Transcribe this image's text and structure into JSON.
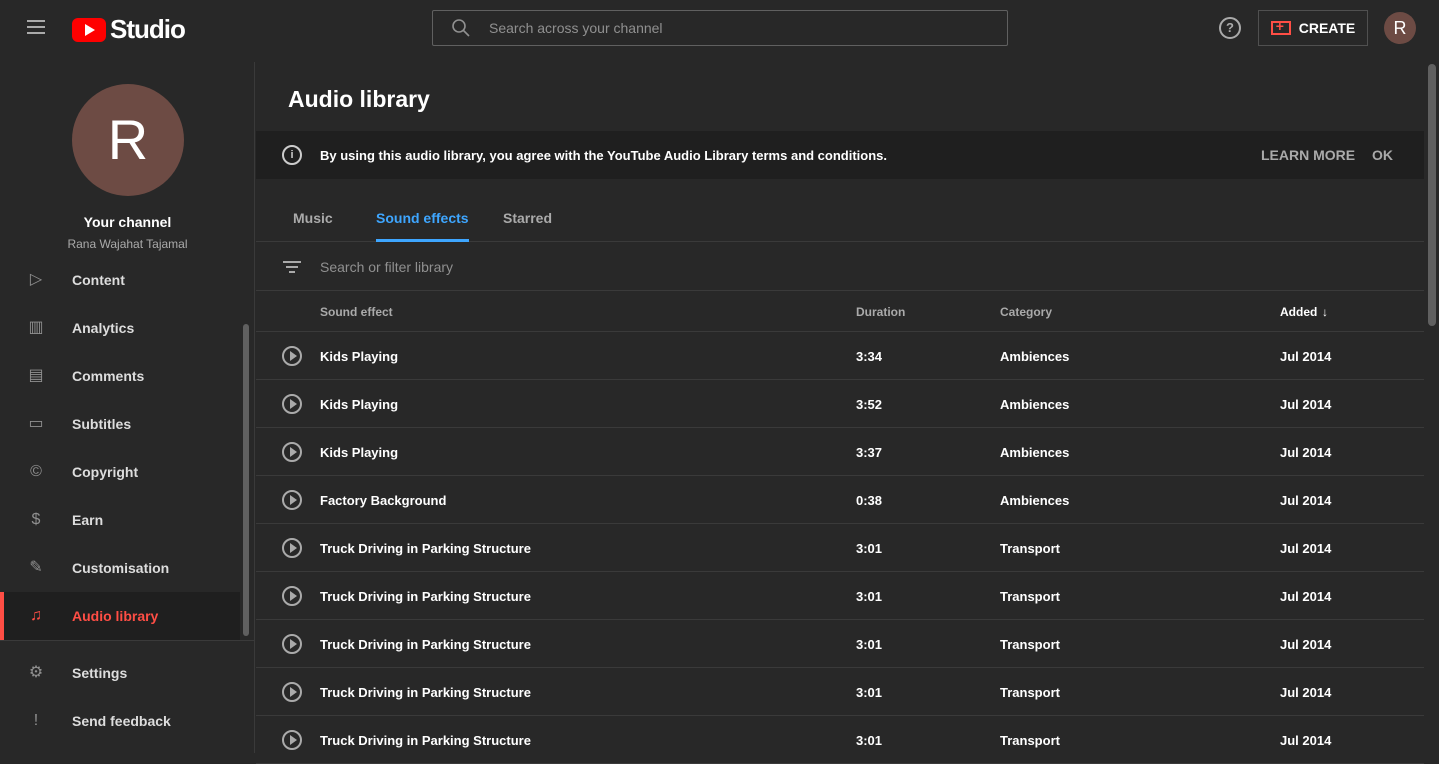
{
  "header": {
    "logo_text": "Studio",
    "search_placeholder": "Search across your channel",
    "help_label": "?",
    "create_label": "CREATE",
    "avatar_initial": "R"
  },
  "sidebar": {
    "avatar_initial": "R",
    "channel_title": "Your channel",
    "channel_name": "Rana Wajahat Tajamal",
    "items": [
      {
        "label": "Content",
        "icon": "content-icon"
      },
      {
        "label": "Analytics",
        "icon": "analytics-icon"
      },
      {
        "label": "Comments",
        "icon": "comments-icon"
      },
      {
        "label": "Subtitles",
        "icon": "subtitles-icon"
      },
      {
        "label": "Copyright",
        "icon": "copyright-icon"
      },
      {
        "label": "Earn",
        "icon": "earn-icon"
      },
      {
        "label": "Customisation",
        "icon": "customisation-icon"
      },
      {
        "label": "Audio library",
        "icon": "audio-library-icon",
        "active": true
      }
    ],
    "footer_items": [
      {
        "label": "Settings",
        "icon": "settings-icon"
      },
      {
        "label": "Send feedback",
        "icon": "feedback-icon"
      }
    ]
  },
  "main": {
    "title": "Audio library",
    "banner": {
      "message": "By using this audio library, you agree with the YouTube Audio Library terms and conditions.",
      "learn_more": "LEARN MORE",
      "ok": "OK"
    },
    "tabs": [
      {
        "label": "Music"
      },
      {
        "label": "Sound effects",
        "active": true
      },
      {
        "label": "Starred"
      }
    ],
    "filter_placeholder": "Search or filter library",
    "columns": {
      "sound_effect": "Sound effect",
      "duration": "Duration",
      "category": "Category",
      "added": "Added"
    },
    "rows": [
      {
        "title": "Kids Playing",
        "duration": "3:34",
        "category": "Ambiences",
        "added": "Jul 2014"
      },
      {
        "title": "Kids Playing",
        "duration": "3:52",
        "category": "Ambiences",
        "added": "Jul 2014"
      },
      {
        "title": "Kids Playing",
        "duration": "3:37",
        "category": "Ambiences",
        "added": "Jul 2014"
      },
      {
        "title": "Factory Background",
        "duration": "0:38",
        "category": "Ambiences",
        "added": "Jul 2014"
      },
      {
        "title": "Truck Driving in Parking Structure",
        "duration": "3:01",
        "category": "Transport",
        "added": "Jul 2014"
      },
      {
        "title": "Truck Driving in Parking Structure",
        "duration": "3:01",
        "category": "Transport",
        "added": "Jul 2014"
      },
      {
        "title": "Truck Driving in Parking Structure",
        "duration": "3:01",
        "category": "Transport",
        "added": "Jul 2014"
      },
      {
        "title": "Truck Driving in Parking Structure",
        "duration": "3:01",
        "category": "Transport",
        "added": "Jul 2014"
      },
      {
        "title": "Truck Driving in Parking Structure",
        "duration": "3:01",
        "category": "Transport",
        "added": "Jul 2014"
      }
    ]
  },
  "colors": {
    "accent": "#3ea6ff",
    "brand": "#ff0000",
    "active_nav": "#ff4e45",
    "background": "#282828"
  }
}
